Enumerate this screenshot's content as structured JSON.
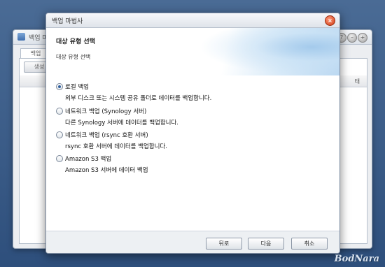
{
  "background_window": {
    "title": "백업 마",
    "tab_label": "백업",
    "create_button": "생성",
    "column_fragment": "태"
  },
  "dialog": {
    "title": "백업 마법사",
    "header": {
      "title": "대상 유형 선택",
      "subtitle": "대상 유형 선택"
    },
    "options": [
      {
        "label": "로컬 백업",
        "description": "외부 디스크 또는 시스템 공유 폴더로 데이터를 백업합니다.",
        "checked": true
      },
      {
        "label": "네트워크 백업 (Synology 서버)",
        "description": "다른 Synology 서버에 데이터를 백업합니다.",
        "checked": false
      },
      {
        "label": "네트워크 백업 (rsync 호환 서버)",
        "description": "rsync 호환 서버에 데이터를 백업합니다.",
        "checked": false
      },
      {
        "label": "Amazon S3 백업",
        "description": "Amazon S3 서버에 데이터 백업",
        "checked": false
      }
    ],
    "buttons": {
      "back": "뒤로",
      "next": "다음",
      "cancel": "취소"
    }
  },
  "watermark": "BodNara",
  "colors": {
    "desktop": "#3b5c88",
    "radio_accent": "#2f5f9e",
    "close_button": "#d03a14"
  }
}
